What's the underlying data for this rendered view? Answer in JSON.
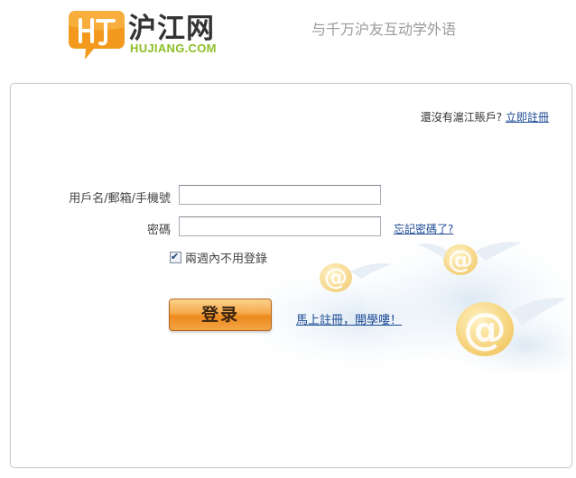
{
  "header": {
    "brand_name": "沪江网",
    "brand_domain": "HUJIANG.COM",
    "slogan": "与千万沪友互动学外语"
  },
  "login": {
    "no_account_text": "還沒有滬江賬戶?",
    "register_link": "立即註冊",
    "username_label": "用戶名/郵箱/手機號",
    "username_value": "",
    "password_label": "密碼",
    "password_value": "",
    "forgot_password": "忘記密碼了?",
    "remember_label": "兩週內不用登錄",
    "remember_checked": true,
    "login_button": "登录",
    "register_prompt": "馬上註冊，開學嘍！"
  },
  "icons": {
    "logo": "hujiang-logo-icon",
    "decoration": "winged-at-sign-icon"
  },
  "colors": {
    "logo_orange": "#f39a1e",
    "domain_green": "#8cbf26",
    "link_blue": "#1c4a94",
    "button_orange": "#f6a94a"
  }
}
